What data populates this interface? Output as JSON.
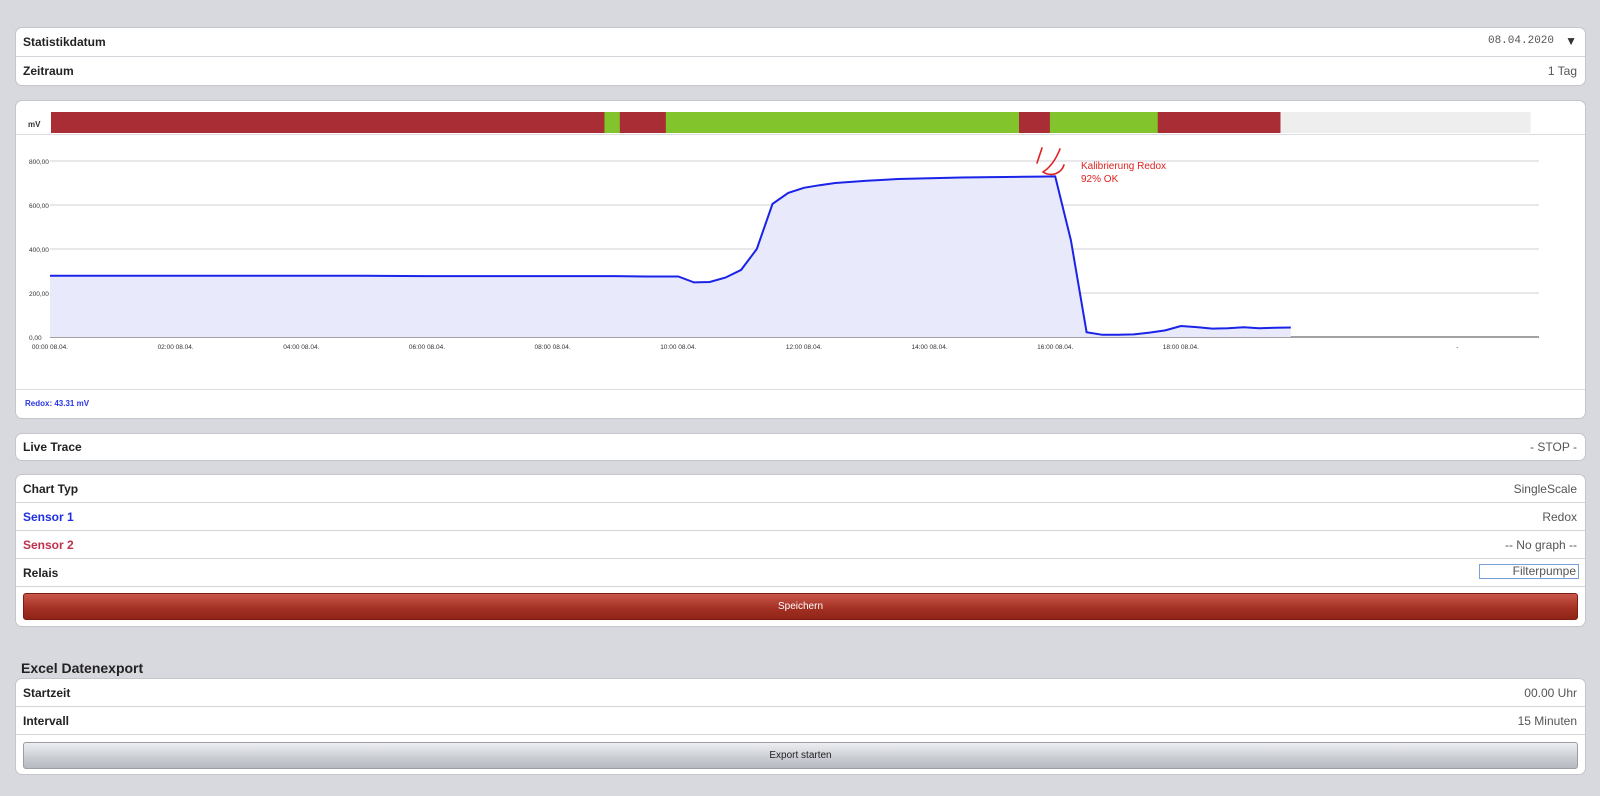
{
  "settings": {
    "stat_date_label": "Statistikdatum",
    "stat_date_value": "08.04.2020",
    "period_label": "Zeitraum",
    "period_value": "1 Tag"
  },
  "chart_card": {
    "unit_label": "mV",
    "status_bar": [
      {
        "state": "bad",
        "from": 0,
        "to": 0.3742
      },
      {
        "state": "good",
        "from": 0.3742,
        "to": 0.3846
      },
      {
        "state": "bad",
        "from": 0.3846,
        "to": 0.4157
      },
      {
        "state": "good",
        "from": 0.4157,
        "to": 0.6545
      },
      {
        "state": "bad",
        "from": 0.6545,
        "to": 0.6754
      },
      {
        "state": "good",
        "from": 0.6754,
        "to": 0.7483
      },
      {
        "state": "bad",
        "from": 0.7483,
        "to": 0.8313
      },
      {
        "state": "empty",
        "from": 0.8313,
        "to": 1
      }
    ],
    "colors": {
      "bad": "#a82d35",
      "good": "#82c42c",
      "empty": "#eeeeee",
      "line": "#1a23e8",
      "fill": "#e8e9fb",
      "annotation": "#e02020"
    },
    "annotation": {
      "line1": "Kalibrierung Redox",
      "line2": "92% OK"
    },
    "legend": "Redox: 43.31 mV"
  },
  "chart_data": {
    "type": "area",
    "ylim": [
      0,
      800
    ],
    "yticks": [
      "800,00",
      "600,00",
      "400,00",
      "200,00",
      "0,00"
    ],
    "ytick_values": [
      800,
      600,
      400,
      200,
      0
    ],
    "xticks": [
      "00:00 08.04.",
      "02:00 08.04.",
      "04:00 08.04.",
      "06:00 08.04.",
      "08:00 08.04.",
      "10:00 08.04.",
      "12:00 08.04.",
      "14:00 08.04.",
      "16:00 08.04.",
      "18:00 08.04.",
      "-"
    ],
    "xtick_hours": [
      0,
      2,
      4,
      6,
      8,
      10,
      12,
      14,
      16,
      18,
      22.4
    ],
    "xlim_hours": [
      0,
      23.7
    ],
    "series": [
      {
        "x_hours": [
          0,
          1,
          2,
          3,
          4,
          5,
          6,
          7,
          8,
          9,
          9.5,
          10,
          10.25,
          10.5,
          10.75,
          11.0,
          11.25,
          11.5,
          11.75,
          12.0,
          12.25,
          12.5,
          13,
          13.5,
          14,
          14.5,
          15,
          15.5,
          15.75,
          16.0,
          16.25,
          16.5,
          16.75,
          17.0,
          17.25,
          17.5,
          17.75,
          18,
          18.25,
          18.5,
          18.75,
          19,
          19.25,
          19.5,
          19.75
        ],
        "values": [
          278,
          278,
          278,
          278,
          278,
          278,
          277,
          277,
          277,
          277,
          275,
          275,
          248,
          250,
          270,
          305,
          400,
          605,
          655,
          678,
          690,
          700,
          710,
          718,
          722,
          725,
          727,
          728,
          729,
          730,
          440,
          22,
          10,
          10,
          12,
          20,
          30,
          50,
          45,
          38,
          40,
          44,
          40,
          42,
          43
        ]
      }
    ]
  },
  "live_trace": {
    "label": "Live Trace",
    "value": "- STOP -"
  },
  "config": {
    "chart_type_label": "Chart Typ",
    "chart_type_value": "SingleScale",
    "sensor1_label": "Sensor 1",
    "sensor1_value": "Redox",
    "sensor2_label": "Sensor 2",
    "sensor2_value": "-- No graph --",
    "relay_label": "Relais",
    "relay_value": "Filterpumpe",
    "save_label": "Speichern",
    "sensor1_color": "#1f2fe0",
    "sensor2_color": "#c0304a"
  },
  "export": {
    "title": "Excel Datenexport",
    "start_label": "Startzeit",
    "start_value": "00.00 Uhr",
    "interval_label": "Intervall",
    "interval_value": "15 Minuten",
    "button_label": "Export starten"
  }
}
